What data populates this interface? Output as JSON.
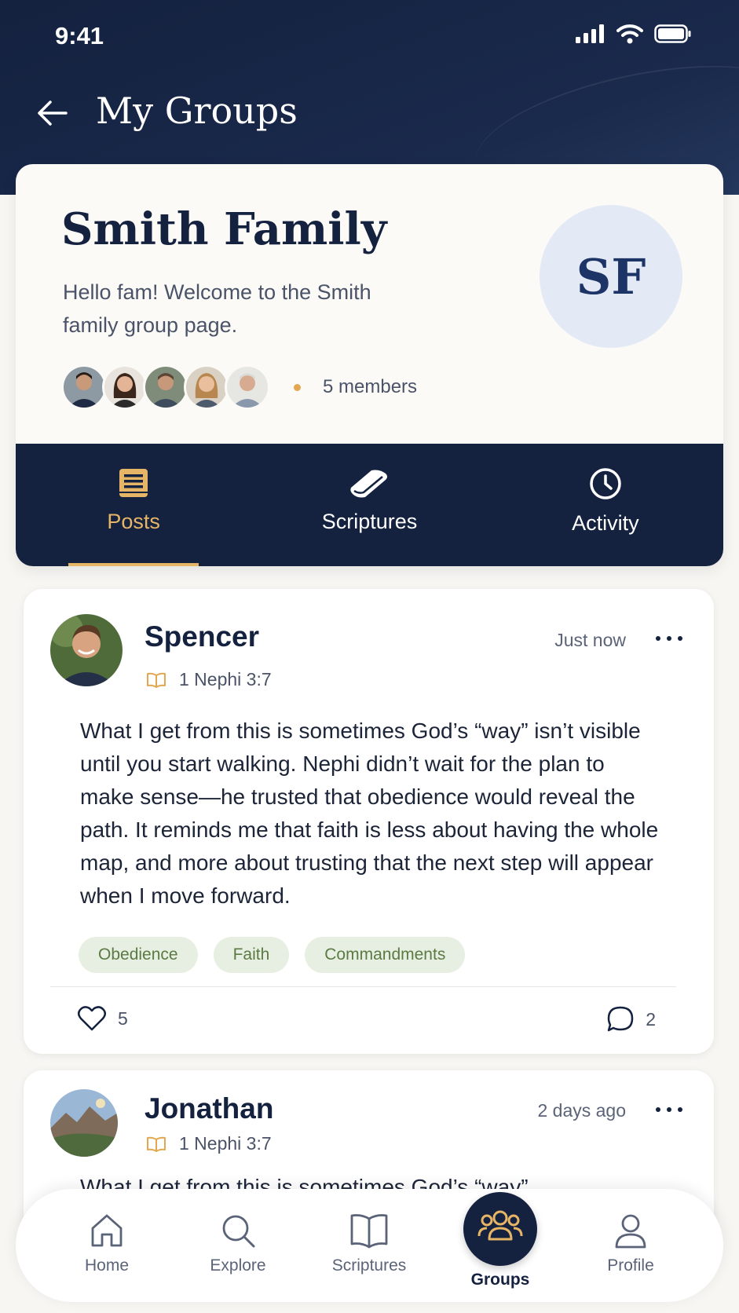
{
  "status_bar": {
    "time": "9:41"
  },
  "header": {
    "title": "My Groups"
  },
  "group": {
    "name": "Smith Family",
    "description": "Hello fam! Welcome to the Smith family group page.",
    "initials": "SF",
    "member_count": "5 members"
  },
  "tabs": [
    {
      "label": "Posts",
      "icon": "book-icon",
      "active": true
    },
    {
      "label": "Scriptures",
      "icon": "scripture-book-icon",
      "active": false
    },
    {
      "label": "Activity",
      "icon": "clock-icon",
      "active": false
    }
  ],
  "posts": [
    {
      "author": "Spencer",
      "reference": "1 Nephi 3:7",
      "time": "Just now",
      "body": "What I get from this is sometimes God’s “way” isn’t visible until you start walking. Nephi didn’t wait for the plan to make sense—he trusted that obedience would reveal the path. It reminds me that faith is less about having the whole map, and more about trusting that the next step will appear when I move forward.",
      "tags": [
        "Obedience",
        "Faith",
        "Commandments"
      ],
      "likes": "5",
      "comments": "2"
    },
    {
      "author": "Jonathan",
      "reference": "1 Nephi 3:7",
      "time": "2 days ago",
      "body": "What I get from this is sometimes God’s “way”"
    }
  ],
  "bottom_nav": [
    {
      "label": "Home",
      "icon": "home-icon"
    },
    {
      "label": "Explore",
      "icon": "search-icon"
    },
    {
      "label": "Scriptures",
      "icon": "open-book-icon"
    },
    {
      "label": "Groups",
      "icon": "groups-icon",
      "active": true
    },
    {
      "label": "Profile",
      "icon": "profile-icon"
    }
  ],
  "colors": {
    "navy": "#14213f",
    "gold": "#e7b566",
    "tag_bg": "#e6efe1",
    "tag_text": "#5c7a43",
    "avatar_bg": "#e3e9f5"
  }
}
